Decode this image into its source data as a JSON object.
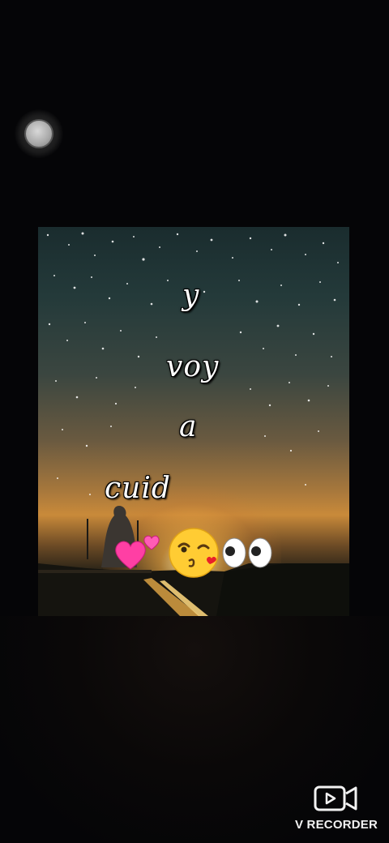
{
  "video": {
    "lyrics": [
      "y",
      "voy",
      "a",
      "cuid"
    ],
    "emojis": [
      "two-hearts",
      "kissing-face-winking",
      "eyes"
    ]
  },
  "overlay": {
    "floating_button": "screen-recorder-float-ball",
    "watermark": {
      "label": "V RECORDER",
      "icon": "video-camera-icon"
    }
  },
  "colors": {
    "background": "#050507",
    "sky_top": "#1a2c2e",
    "horizon_glow": "#c98a3a",
    "heart_pink": "#ff3fa4",
    "emoji_yellow": "#ffcc33"
  }
}
